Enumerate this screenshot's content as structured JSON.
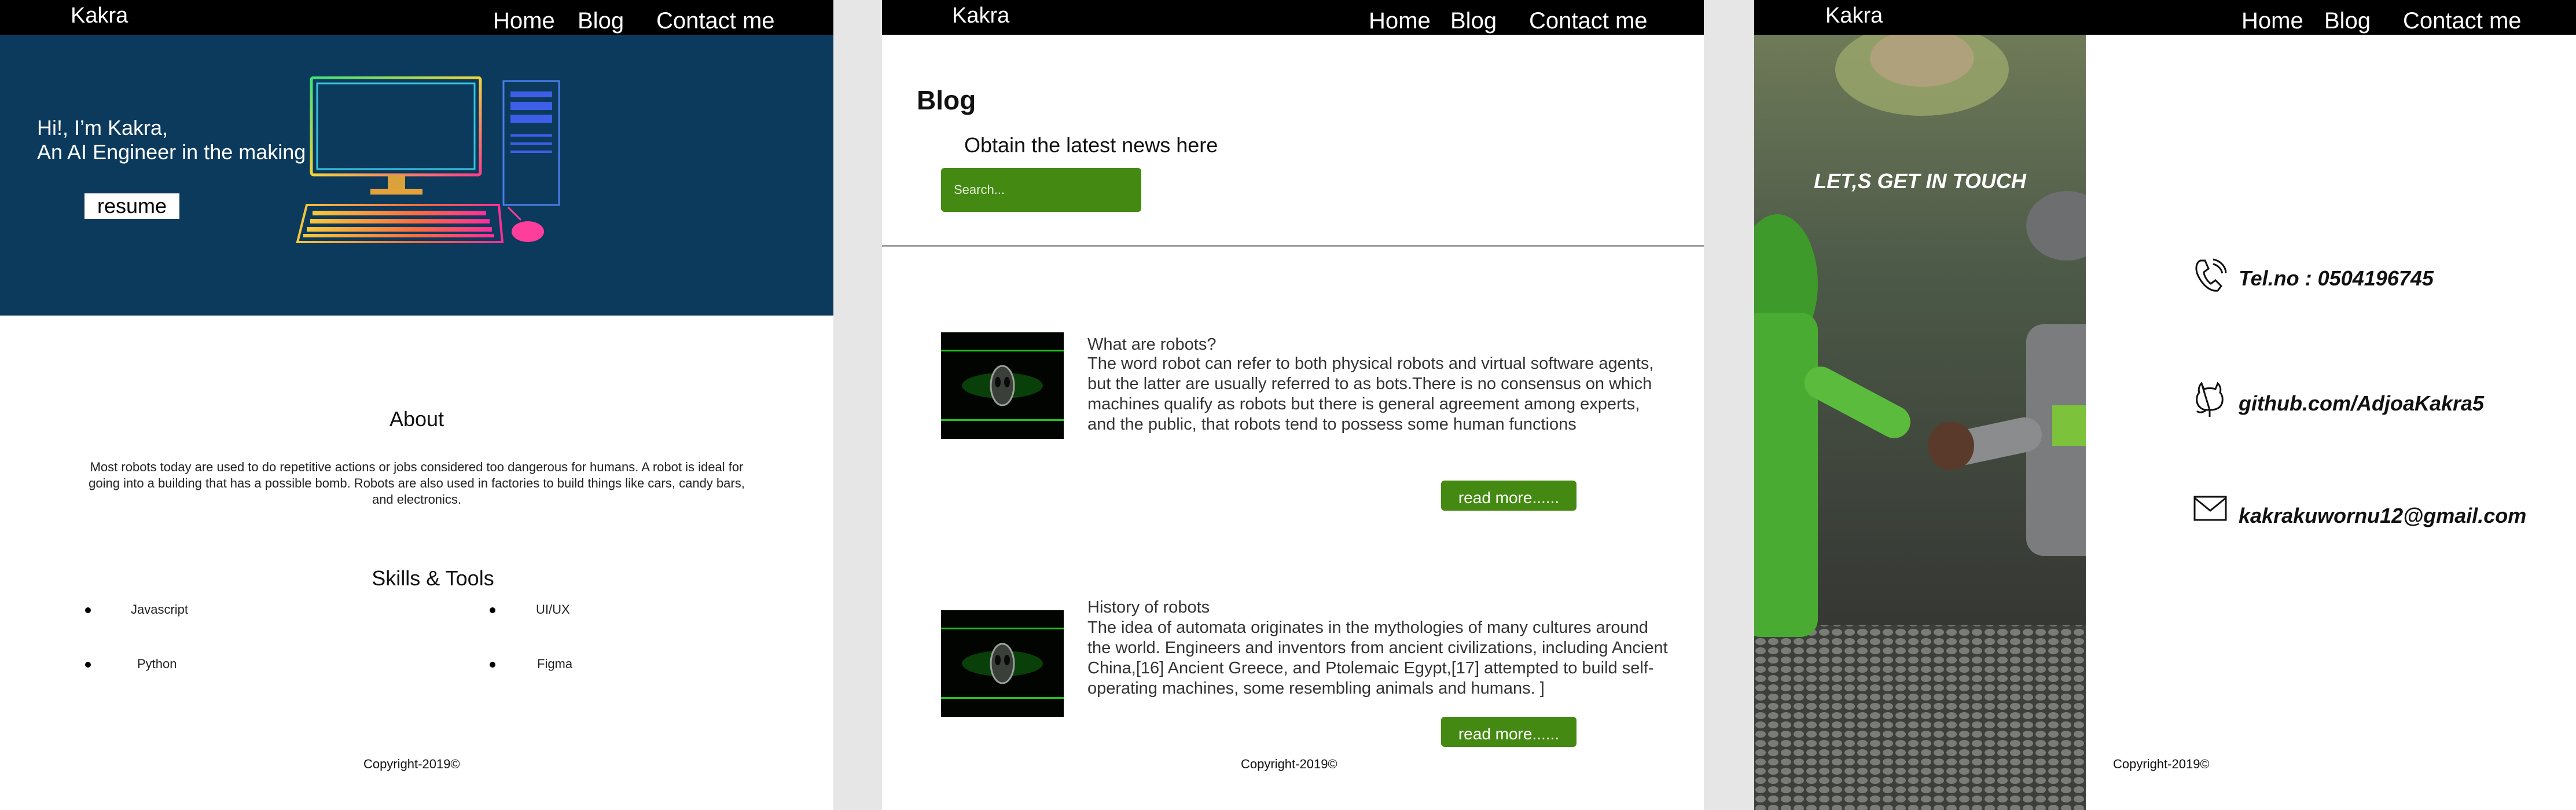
{
  "nav": {
    "brand": "Kakra",
    "home": "Home",
    "blog": "Blog",
    "contact": "Contact me"
  },
  "home": {
    "greeting_line1": "Hi!, I’m Kakra,",
    "greeting_line2": "An AI Engineer in  the making",
    "resume_label": "resume",
    "about_title": "About",
    "about_text": "Most robots today are used to do repetitive actions or jobs considered too dangerous for humans. A robot is ideal for going into a building that has a possible bomb. Robots are also used in factories to build things like cars, candy bars, and electronics.",
    "skills_title": "Skills & Tools",
    "skills": [
      "Javascript",
      "UI/UX",
      "Python",
      "Figma"
    ],
    "copyright": "Copyright-2019©"
  },
  "blog": {
    "title": "Blog",
    "subtitle": "Obtain the latest news here",
    "search_placeholder": "Search...",
    "posts": [
      {
        "title": "What are robots?",
        "body": "The word robot can refer to both physical robots and virtual software agents, but the latter are usually referred to as bots.There is no consensus on which machines qualify as robots but there is general agreement among experts, and the public, that robots tend to possess some human functions",
        "read_more": "read more......"
      },
      {
        "title": "History of  robots",
        "body": "The idea of automata originates in the mythologies of many cultures around the world. Engineers and inventors from ancient civilizations, including Ancient China,[16] Ancient Greece, and Ptolemaic Egypt,[17] attempted to build self-operating machines, some resembling animals and humans. ]",
        "read_more": "read more......"
      }
    ],
    "copyright": "Copyright-2019©"
  },
  "contact": {
    "photo_title": "LET,S GET IN TOUCH",
    "phone": "Tel.no : 0504196745",
    "github": "github.com/AdjoaKakra5",
    "email": "kakrakuwornu12@gmail.com",
    "copyright": "Copyright-2019©"
  },
  "colors": {
    "hero_bg": "#0b3a5c",
    "accent_green": "#448a12",
    "nav_bg": "#000000"
  }
}
